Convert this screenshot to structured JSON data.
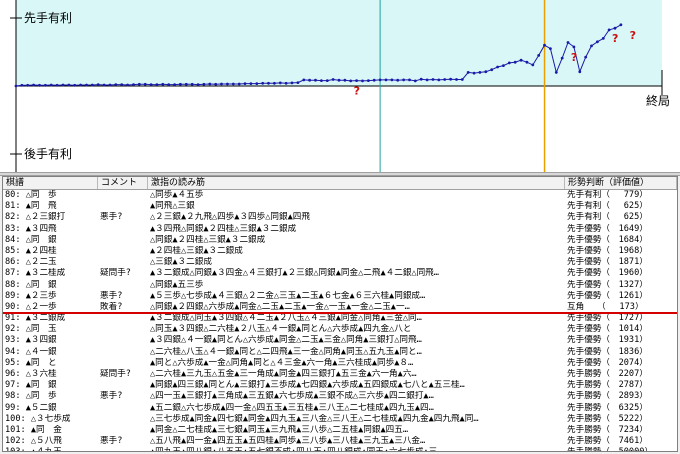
{
  "graph": {
    "label_top": "先手有利",
    "label_bottom": "後手有利",
    "label_end": "終局",
    "question_mark": "?",
    "bg_color": "#d9f7f7",
    "line_color": "#1a1aa8",
    "cursor_color": "#e8a000",
    "teal_color": "#20a0a0",
    "question_color": "#cc1010"
  },
  "table": {
    "headers": [
      "棋譜",
      "コメント",
      "激指の読み筋",
      "形勢判断（評価値）"
    ],
    "rows": [
      {
        "move": "80: △同　歩",
        "comment": "",
        "pv": "△同歩▲４五歩",
        "eval": "先手有利（　 779）"
      },
      {
        "move": "81: ▲同　飛",
        "comment": "",
        "pv": "▲同飛△三銀",
        "eval": "先手有利（　 625）"
      },
      {
        "move": "82: △２三銀打",
        "comment": "悪手?",
        "pv": "△２三銀▲２九飛△四歩▲３四歩△同銀▲四飛",
        "eval": "先手有利（　 625）"
      },
      {
        "move": "83: ▲３四飛",
        "comment": "",
        "pv": "▲３四飛△同銀▲２四桂△三銀▲３二銀成",
        "eval": "先手優勢（　1649）"
      },
      {
        "move": "84: △同　銀",
        "comment": "",
        "pv": "△同銀▲２四桂△三銀▲３二銀成",
        "eval": "先手優勢（　1684）"
      },
      {
        "move": "85: ▲２四桂",
        "comment": "",
        "pv": "▲２四桂△三銀▲３二銀成",
        "eval": "先手優勢（　1968）"
      },
      {
        "move": "86: △２二玉",
        "comment": "",
        "pv": "△三銀▲３二銀成",
        "eval": "先手優勢（　1871）"
      },
      {
        "move": "87: ▲３二桂成",
        "comment": "疑問手?",
        "pv": "▲３二銀成△同銀▲３四金△４三銀打▲２三銀△同銀▲同金△二飛▲４二銀△同飛…",
        "eval": "先手優勢（　1960）"
      },
      {
        "move": "88: △同　銀",
        "comment": "",
        "pv": "△同銀▲五三歩",
        "eval": "先手優勢（　1327）"
      },
      {
        "move": "89: ▲２三歩",
        "comment": "悪手?",
        "pv": "▲５三歩△七歩成▲４三銀△２二金△三玉▲二玉▲６七金▲６三六桂▲同銀成…",
        "eval": "先手優勢（　1261）"
      },
      {
        "move": "90: △２一歩",
        "comment": "敗着?",
        "pv": "△同銀▲２四銀△六歩成▲同金△二玉▲二玉▲一金△一玉▲一金△二玉▲一…",
        "eval": "互角　　（　 173）"
      },
      {
        "move": "91: ▲３二銀成",
        "comment": "",
        "pv": "▲３二銀成△同玉▲３四銀△４二玉▲２八玉△４三銀▲同金△同角▲三金△同…",
        "eval": "先手優勢（　1727）"
      },
      {
        "move": "92: △同　玉",
        "comment": "",
        "pv": "△同玉▲３四銀△二六桂▲２八玉△４一銀▲同とん△六歩成▲四九金△八と",
        "eval": "先手優勢（　1014）"
      },
      {
        "move": "93: ▲３四銀",
        "comment": "",
        "pv": "▲３四銀△４一銀▲同とん△六歩成▲同金△二玉▲三金△同角▲三銀打△同飛…",
        "eval": "先手優勢（　1931）"
      },
      {
        "move": "94: △４一銀",
        "comment": "",
        "pv": "△二六桂△八玉△４一銀▲同と△二四飛▲三一金△同角▲同玉△五九玉▲同と…",
        "eval": "先手優勢（　1836）"
      },
      {
        "move": "95: ▲同　と",
        "comment": "",
        "pv": "▲同と△六歩成▲一金△同角▲同と△４三金▲六一角▲三六桂成▲同歩▲８…",
        "eval": "先手優勢（　2074）"
      },
      {
        "move": "96: △３六桂",
        "comment": "疑問手?",
        "pv": "△二六桂▲三九玉△五金▲三一角成▲同金▲四三銀打▲五三金▲六一角▲六…",
        "eval": "先手勝勢（　2207）"
      },
      {
        "move": "97: ▲同　銀",
        "comment": "",
        "pv": "▲同銀▲四三銀▲同とん▲三銀打▲三歩成▲七四銀▲六歩成▲五四銀成▲七八と▲五三桂…",
        "eval": "先手勝勢（　2787）"
      },
      {
        "move": "98: △同　歩",
        "comment": "悪手?",
        "pv": "△四一玉▲三銀打▲三角成▲三五銀▲六七歩成▲三銀不成△三六歩▲四二銀打▲…",
        "eval": "先手勝勢（　2893）"
      },
      {
        "move": "99: ▲５二銀",
        "comment": "",
        "pv": "▲五二銀△六七歩成▲四一金△四五玉▲三五桂▲三八王△二七桂成▲四九玉▲四…",
        "eval": "先手勝勢（　6325）"
      },
      {
        "move": "100: △３七歩成",
        "comment": "",
        "pv": "△三七歩成▲同金▲四七銀▲同金▲四九玉▲三八金△三八王△二七桂成▲四九金▲四九飛▲同…",
        "eval": "先手勝勢（　5222）"
      },
      {
        "move": "101: ▲同　金",
        "comment": "",
        "pv": "▲同金△二七桂成▲三七銀▲同玉▲三九飛▲三八歩△二五桂▲同銀▲四五…",
        "eval": "先手勝勢（　7234）"
      },
      {
        "move": "102: △５八飛",
        "comment": "悪手?",
        "pv": "△五八飛▲四一金▲四五玉▲五四桂▲同歩▲三八歩▲三八桂▲三九玉▲三八金…",
        "eval": "先手勝勢（　7461）"
      },
      {
        "move": "103: ▲４九王",
        "comment": "",
        "pv": "▲四九王▲四八銀▲八五玉▲五七銀不成▲四八玉▲四八銀成▲同玉▲六七歩成▲三…",
        "eval": "先手勝勢（　50000）"
      }
    ]
  },
  "chart_data": {
    "type": "line",
    "x": [
      0,
      1,
      2,
      3,
      4,
      5,
      6,
      7,
      8,
      9,
      10,
      11,
      12,
      13,
      14,
      15,
      16,
      17,
      18,
      19,
      20,
      21,
      22,
      23,
      24,
      25,
      26,
      27,
      28,
      29,
      30,
      31,
      32,
      33,
      34,
      35,
      36,
      37,
      38,
      39,
      40,
      41,
      42,
      43,
      44,
      45,
      46,
      47,
      48,
      49,
      50,
      51,
      52,
      53,
      54,
      55,
      56,
      57,
      58,
      59,
      60,
      61,
      62,
      63,
      64,
      65,
      66,
      67,
      68,
      69,
      70,
      71,
      72,
      73,
      74,
      75,
      76,
      77,
      78,
      79,
      80,
      81,
      82,
      83,
      84,
      85,
      86,
      87,
      88,
      89,
      90,
      91,
      92,
      93,
      94,
      95,
      96,
      97,
      98,
      99,
      100,
      101,
      102,
      103
    ],
    "values": [
      0,
      20,
      20,
      30,
      20,
      20,
      30,
      20,
      30,
      30,
      20,
      30,
      30,
      30,
      40,
      30,
      30,
      40,
      40,
      30,
      40,
      50,
      50,
      40,
      40,
      50,
      40,
      40,
      50,
      50,
      50,
      40,
      50,
      60,
      50,
      60,
      60,
      60,
      60,
      70,
      70,
      70,
      80,
      80,
      80,
      90,
      80,
      90,
      100,
      180,
      170,
      170,
      160,
      160,
      190,
      170,
      170,
      150,
      160,
      150,
      160,
      170,
      180,
      180,
      180,
      170,
      180,
      180,
      150,
      200,
      180,
      190,
      180,
      190,
      200,
      190,
      190,
      400,
      380,
      400,
      420,
      480,
      560,
      600,
      680,
      700,
      760,
      700,
      620,
      900,
      1200,
      1100,
      400,
      820,
      1280,
      1150,
      420,
      850,
      1180,
      1300,
      1400,
      1650,
      1700,
      1800
    ],
    "ylim": [
      -2000,
      2000
    ],
    "xlim": [
      0,
      110
    ],
    "cursor_x": 90,
    "teal_x": 62,
    "question_marks": [
      58,
      95,
      102,
      105
    ]
  }
}
